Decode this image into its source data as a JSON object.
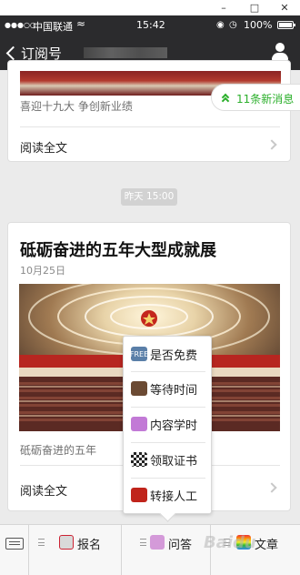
{
  "window": {
    "minimize_icon": "minimize-icon",
    "maximize_icon": "maximize-icon",
    "close_icon": "close-icon"
  },
  "status_bar": {
    "carrier": "中国联通",
    "time": "15:42",
    "battery": "100%"
  },
  "nav": {
    "back_label": "订阅号",
    "profile_icon": "person-icon"
  },
  "article1": {
    "caption": "喜迎十九大 争创新业绩",
    "read_label": "阅读全文"
  },
  "new_messages": {
    "label": "11条新消息"
  },
  "timestamp": "昨天 15:00",
  "article2": {
    "title": "砥砺奋进的五年大型成就展",
    "date": "10月25日",
    "caption": "砥砺奋进的五年",
    "read_label": "阅读全文"
  },
  "popup_menu": [
    {
      "label": "是否免费",
      "icon": "free-icon",
      "icon_text": "FREE"
    },
    {
      "label": "等待时间",
      "icon": "coffee-icon"
    },
    {
      "label": "内容学时",
      "icon": "person-raising-hand-icon"
    },
    {
      "label": "领取证书",
      "icon": "checkered-flag-icon"
    },
    {
      "label": "转接人工",
      "icon": "telephone-icon"
    }
  ],
  "bottom_menu": [
    {
      "label": "报名",
      "icon": "hospital-icon"
    },
    {
      "label": "问答",
      "icon": "person-tipping-hand-icon"
    },
    {
      "label": "文章",
      "icon": "rainbow-icon"
    }
  ],
  "watermark": "Baidu",
  "colors": {
    "nav_bg": "#2b2b2d",
    "accent_green": "#2baf2b",
    "page_bg": "#ebebeb"
  }
}
